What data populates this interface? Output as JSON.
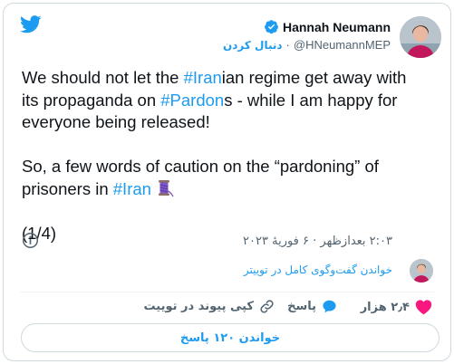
{
  "author": {
    "display_name": "Hannah Neumann",
    "handle": "@HNeumannMEP",
    "follow_label": "دنبال کردن",
    "separator": "·"
  },
  "tweet": {
    "p1_a": "We should not let the ",
    "tag_iran_1": "#Iran",
    "p1_b": "ian regime get away with its propaganda on ",
    "tag_pardon": "#Pardon",
    "p1_c": "s - while I am happy for everyone being released!",
    "p2_a": "So, a few words of caution on the “pardoning” of prisoners in ",
    "tag_iran_2": "#Iran",
    "p3": "(1/4)"
  },
  "meta": {
    "timestamp": "۲:۰۳ بعدازظهر · ۶ فوریهٔ ۲۰۲۳",
    "conversation_link": "خواندن گفت‌وگوی کامل در توییتر"
  },
  "actions": {
    "like_count": "۲٫۴ هزار",
    "reply_label": "پاسخ",
    "copy_link_label": "کپی پیوند در توییت"
  },
  "footer": {
    "read_replies": "خواندن ۱۲۰ پاسخ"
  },
  "colors": {
    "accent": "#1d9bf0",
    "like": "#f91880",
    "text": "#0f1419",
    "muted": "#536471",
    "border": "#cfd9de"
  },
  "icons": {
    "logo": "twitter-bird-icon",
    "verified": "verified-badge-icon",
    "info": "info-icon",
    "like": "heart-icon",
    "reply": "reply-bubble-icon",
    "copy": "link-icon",
    "thread": "thread-spool-emoji"
  }
}
